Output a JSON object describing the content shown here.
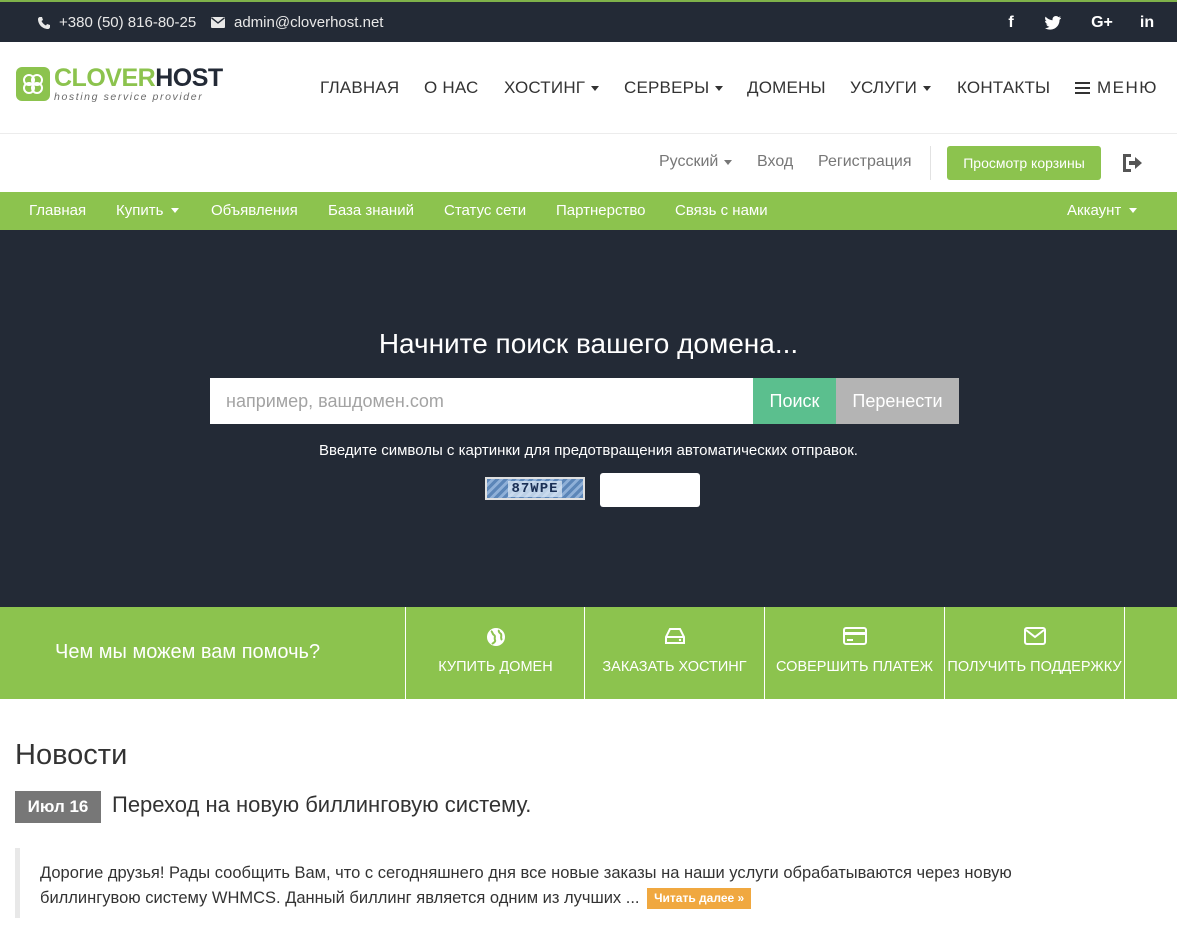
{
  "topbar": {
    "phone": "+380 (50) 816-80-25",
    "email": "admin@cloverhost.net",
    "social": [
      {
        "icon": "facebook-icon",
        "label": "f"
      },
      {
        "icon": "twitter-icon",
        "label": ""
      },
      {
        "icon": "google-plus-icon",
        "label": "G+"
      },
      {
        "icon": "linkedin-icon",
        "label": "in"
      }
    ]
  },
  "logo": {
    "title_a": "CLOVER",
    "title_b": "HOST",
    "subtitle": "hosting service provider"
  },
  "mainnav": {
    "home": "ГЛАВНАЯ",
    "about": "О НАС",
    "hosting": "ХОСТИНГ",
    "servers": "СЕРВЕРЫ",
    "domains": "ДОМЕНЫ",
    "services": "УСЛУГИ",
    "contacts": "КОНТАКТЫ",
    "menu": "МЕНЮ"
  },
  "utility": {
    "language": "Русский",
    "login": "Вход",
    "register": "Регистрация",
    "cart": "Просмотр корзины"
  },
  "clientnav": {
    "home": "Главная",
    "buy": "Купить",
    "announcements": "Объявления",
    "knowledgebase": "База знаний",
    "network_status": "Статус сети",
    "affiliates": "Партнерство",
    "contact": "Связь с нами",
    "account": "Аккаунт"
  },
  "hero": {
    "title": "Начните поиск вашего домена...",
    "placeholder": "например, вашдомен.com",
    "search": "Поиск",
    "transfer": "Перенести",
    "captcha_prompt": "Введите символы с картинки для предотвращения автоматических отправок.",
    "captcha_code": "87WPE"
  },
  "help": {
    "title": "Чем мы можем вам помочь?",
    "items": [
      {
        "label": "КУПИТЬ ДОМЕН",
        "icon": "globe-icon"
      },
      {
        "label": "ЗАКАЗАТЬ ХОСТИНГ",
        "icon": "hdd-icon"
      },
      {
        "label": "СОВЕРШИТЬ ПЛАТЕЖ",
        "icon": "credit-card-icon"
      },
      {
        "label": "ПОЛУЧИТЬ ПОДДЕРЖКУ",
        "icon": "envelope-icon"
      }
    ]
  },
  "news": {
    "title": "Новости",
    "date": "Июл 16",
    "headline": "Переход на новую биллинговую систему.",
    "body": "Дорогие друзья! Рады сообщить Вам, что с сегодняшнего дня все новые заказы на наши услуги обрабатываются через новую биллингувою систему WHMCS.  Данный биллинг является одним из лучших ...",
    "read_more": "Читать далее »"
  },
  "colors": {
    "accent": "#8cc34e",
    "dark": "#232a36",
    "search": "#5bbf8e",
    "transfer": "#b4b4b4",
    "readmore": "#f0a840"
  }
}
